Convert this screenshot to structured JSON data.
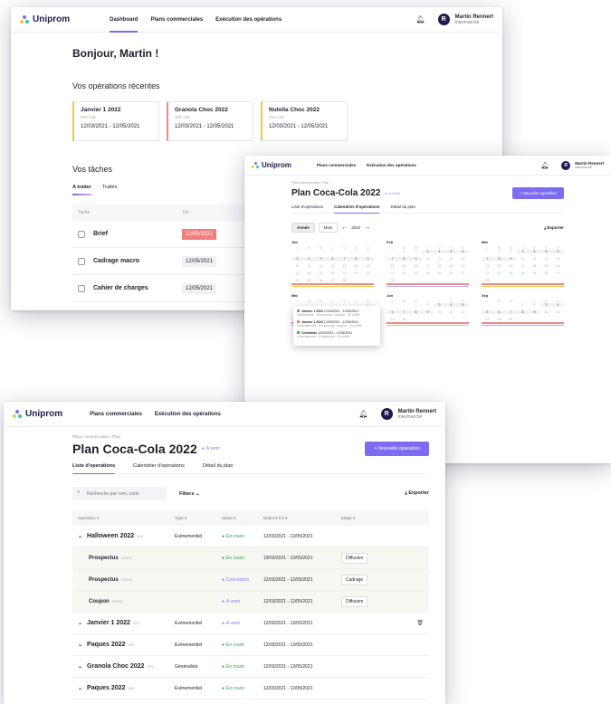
{
  "brand": {
    "name": "Uniprom"
  },
  "user": {
    "name": "Martin Rennert",
    "org": "Intermarché",
    "initial": "R"
  },
  "colors": {
    "accent": "#7c6cf2",
    "yellow": "#f4c542",
    "red": "#ef8a8a",
    "green": "#2aa24a",
    "navy": "#1f1b52"
  },
  "dashboard": {
    "nav": [
      "Dashboard",
      "Plans commerciales",
      "Exécution des opérations"
    ],
    "greeting": "Bonjour, Martin !",
    "recent_title": "Vos opérations récentes",
    "cards": [
      {
        "title": "Janvier 1 2022",
        "code": "003-129",
        "dates": "12/03/2021 - 12/05/2021"
      },
      {
        "title": "Granola Choc 2022",
        "code": "003-129",
        "dates": "12/03/2021 - 12/05/2021"
      },
      {
        "title": "Nutella Choc 2022",
        "code": "003-129",
        "dates": "12/03/2021 - 12/05/2021"
      }
    ],
    "tasks_title": "Vos tâches",
    "tabs": [
      "A traiter",
      "Traités"
    ],
    "task_headers": [
      "Tache",
      "Fin"
    ],
    "tasks": [
      {
        "name": "Brief",
        "due": "12/05/2021"
      },
      {
        "name": "Cadrage macro",
        "due": "12/05/2021"
      },
      {
        "name": "Cahier de charges",
        "due": "12/05/2021"
      }
    ]
  },
  "calendar": {
    "nav": [
      "Plans commerciales",
      "Exécution des opérations"
    ],
    "breadcrumb": "Plans commerciales  /  Plan",
    "title": "Plan Coca-Cola 2022",
    "badge": "A venir",
    "new_button": "+ Nouvelle operation",
    "tabs": [
      "Liste d'opérations",
      "Calendrier d'opérations",
      "Détail du plan"
    ],
    "view_modes": [
      "Année",
      "Mois"
    ],
    "year": "2022",
    "export": "Exporter",
    "months": [
      "Jan",
      "Feb",
      "Mar",
      "Mai",
      "Jun",
      "Sep"
    ],
    "weekdays": [
      "L",
      "M",
      "M",
      "J",
      "V",
      "S",
      "D"
    ],
    "popover": [
      {
        "title": "Janvier 1 2022",
        "dates": "12/03/2021 - 12/05/2021",
        "sub": "Intermarché · Prospectus, coupon · 18 à 689"
      },
      {
        "title": "Janvier 1 2022 ",
        "dates": "12/03/2021 - 12/05/2021",
        "sub": "Lima alarmes · Prospectus, coupon · 18 à 689"
      },
      {
        "title": "Christmas",
        "dates": "12/03/2021 - 12/05/2021",
        "sub": "Lima alarmes · Prospectus · 18 à 689"
      }
    ]
  },
  "list": {
    "nav": [
      "Plans commerciales",
      "Exécution des opérations"
    ],
    "breadcrumb": "Plans commerciales  /  Plan",
    "title": "Plan Coca-Cola 2022",
    "badge": "A venir",
    "new_button": "+ Nouvelle operation",
    "tabs": [
      "Liste d'operations",
      "Calendrier d'operations",
      "Détail du plan"
    ],
    "search_placeholder": "Recherche par nom, code",
    "filters": "Filters",
    "export": "Exporter",
    "headers": [
      "Operation ▾",
      "Type ▾",
      "Statut ▾",
      "Debut ▾   Fin ▾",
      "Etape ▾"
    ],
    "rows": [
      {
        "kind": "main",
        "name": "Halloween 2022",
        "code": "003",
        "type": "Evénementiel",
        "status": "En cours",
        "status_color": "green",
        "dates": "12/03/2021 - 12/05/2021",
        "step": ""
      },
      {
        "kind": "sub",
        "name": "Prospectus",
        "code": "PR001",
        "type": "",
        "status": "En cours",
        "status_color": "green",
        "dates": "19/03/2021 - 12/05/2021",
        "step": "Diffusion"
      },
      {
        "kind": "sub",
        "name": "Prospectus",
        "code": "PR234",
        "type": "",
        "status": "Conception",
        "status_color": "purple",
        "dates": "12/03/2021 - 12/05/2021",
        "step": "Cadrage"
      },
      {
        "kind": "sub",
        "name": "Coupon",
        "code": "PR002",
        "type": "",
        "status": "A venir",
        "status_color": "purple",
        "dates": "12/03/2021 - 12/05/2021",
        "step": "Diffusion"
      },
      {
        "kind": "main",
        "name": "Janvier 1 2022",
        "code": "003",
        "type": "Evénementiel",
        "status": "A venir",
        "status_color": "purple",
        "dates": "12/03/2021 - 12/05/2021",
        "step": ""
      },
      {
        "kind": "main",
        "name": "Paques 2022",
        "code": "003",
        "type": "Evénementiel",
        "status": "En cours",
        "status_color": "green",
        "dates": "12/03/2021 - 12/05/2021",
        "step": ""
      },
      {
        "kind": "main",
        "name": "Granola Choc 2022",
        "code": "003",
        "type": "Généraliste",
        "status": "En cours",
        "status_color": "green",
        "dates": "12/03/2021 - 12/05/2021",
        "step": ""
      },
      {
        "kind": "main",
        "name": "Paques 2022",
        "code": "003",
        "type": "Evénementiel",
        "status": "En cours",
        "status_color": "green",
        "dates": "12/03/2021 - 12/05/2021",
        "step": ""
      }
    ]
  }
}
